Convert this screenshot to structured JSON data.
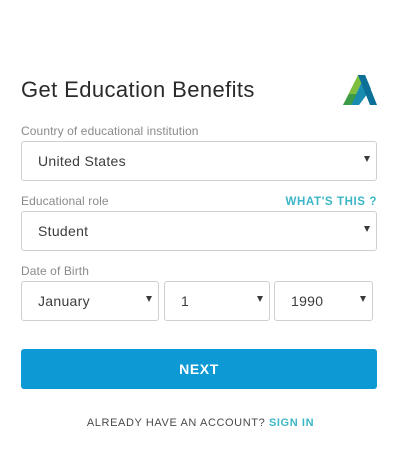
{
  "form": {
    "title": "Get Education Benefits",
    "logo_icon": "autodesk-logo-icon",
    "country": {
      "label": "Country of educational institution",
      "value": "United States"
    },
    "role": {
      "label": "Educational role",
      "help_link": "WHAT'S THIS ?",
      "value": "Student"
    },
    "dob": {
      "label": "Date of Birth",
      "month": "January",
      "day": "1",
      "year": "1990"
    },
    "next_label": "NEXT",
    "account_prompt": "ALREADY HAVE AN ACCOUNT?",
    "sign_in_label": "SIGN IN"
  },
  "colors": {
    "primary_button": "#0d9ad4",
    "link": "#3bb6c6",
    "border": "#cfcfcf"
  }
}
